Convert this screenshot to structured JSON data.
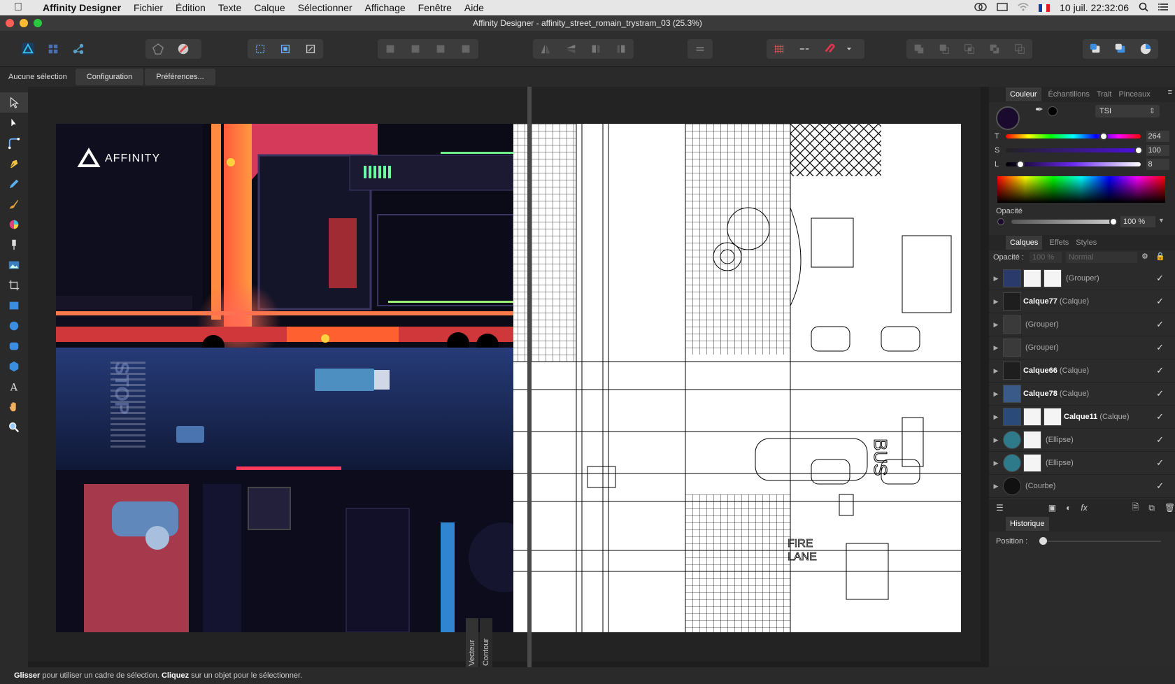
{
  "menubar": {
    "app_name": "Affinity Designer",
    "items": [
      "Fichier",
      "Édition",
      "Texte",
      "Calque",
      "Sélectionner",
      "Affichage",
      "Fenêtre",
      "Aide"
    ],
    "clock": "10 juil.  22:32:06"
  },
  "window": {
    "title": "Affinity Designer - affinity_street_romain_trystram_03 (25.3%)"
  },
  "context_bar": {
    "selection_status": "Aucune sélection",
    "config_button": "Configuration",
    "prefs_button": "Préférences..."
  },
  "canvas": {
    "logo_text": "AFFINITY",
    "road_stop": "STOP",
    "road_bus": "BUS",
    "fire_lane_1": "FIRE",
    "fire_lane_2": "LANE",
    "tab_vector": "Vecteur",
    "tab_outline": "Contour"
  },
  "color_panel": {
    "tabs": [
      "Couleur",
      "Échantillons",
      "Trait",
      "Pinceaux"
    ],
    "model": "TSI",
    "sliders": [
      {
        "label": "T",
        "value": "264",
        "fraction": 0.73
      },
      {
        "label": "S",
        "value": "100",
        "fraction": 1.0
      },
      {
        "label": "L",
        "value": "8",
        "fraction": 0.08
      }
    ],
    "opacity_label": "Opacité",
    "opacity_value": "100 %",
    "accent": "#1a0a2e"
  },
  "layers_panel": {
    "tabs": [
      "Calques",
      "Effets",
      "Styles"
    ],
    "opacity_label": "Opacité :",
    "opacity_value": "100 %",
    "blend_mode": "Normal",
    "rows": [
      {
        "name": "",
        "kind": "(Grouper)"
      },
      {
        "name": "Calque77",
        "kind": "(Calque)"
      },
      {
        "name": "",
        "kind": "(Grouper)"
      },
      {
        "name": "",
        "kind": "(Grouper)"
      },
      {
        "name": "Calque66",
        "kind": "(Calque)"
      },
      {
        "name": "Calque78",
        "kind": "(Calque)"
      },
      {
        "name": "Calque11",
        "kind": "(Calque)"
      },
      {
        "name": "",
        "kind": "(Ellipse)"
      },
      {
        "name": "",
        "kind": "(Ellipse)"
      },
      {
        "name": "",
        "kind": "(Courbe)"
      }
    ]
  },
  "history_panel": {
    "title": "Historique",
    "position_label": "Position :"
  },
  "status": {
    "drag_word": "Glisser",
    "drag_text": " pour utiliser un cadre de sélection. ",
    "click_word": "Cliquez",
    "click_text": " sur un objet pour le sélectionner."
  }
}
